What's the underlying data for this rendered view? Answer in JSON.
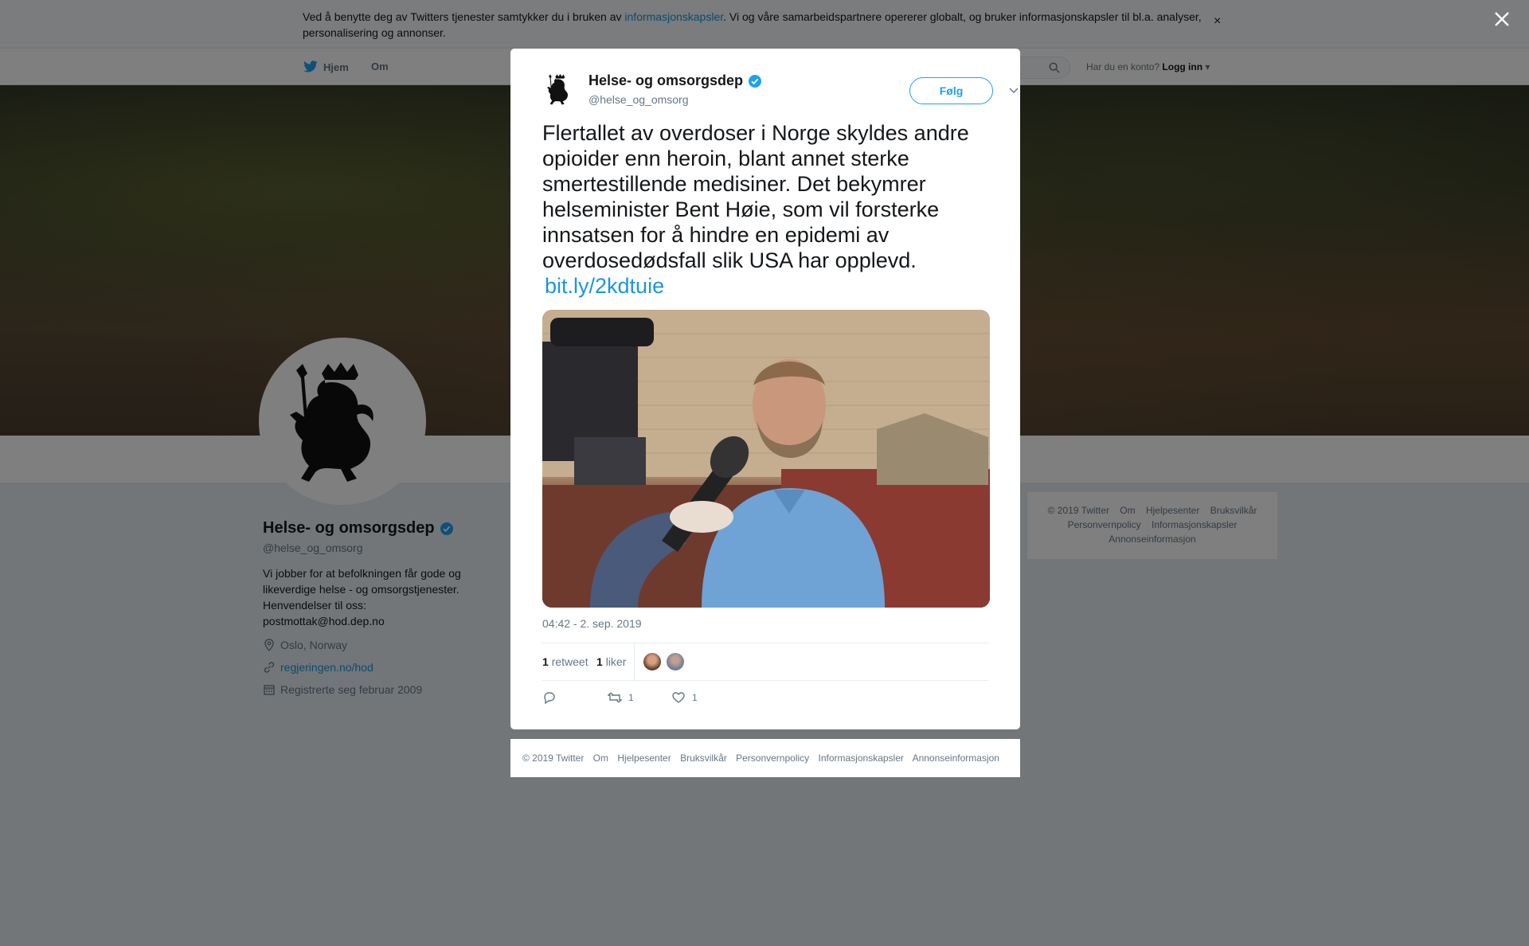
{
  "cookie_bar": {
    "text_before": "Ved å benytte deg av Twitters tjenester samtykker du i bruken av ",
    "link": "informasjonskapsler",
    "text_after": ". Vi og våre samarbeidspartnere opererer globalt, og bruker informasjonskapsler til bl.a. analyser, personalisering og annonser.",
    "close": "×"
  },
  "topnav": {
    "home": "Hjem",
    "about": "Om",
    "login_prompt": "Har du en konto?",
    "login": "Logg inn"
  },
  "profile": {
    "name": "Helse- og omsorgsdep",
    "handle": "@helse_og_omsorg",
    "bio": "Vi jobber for at befolkningen får gode og likeverdige helse - og omsorgstjenester. Henvendelser til oss: postmottak@hod.dep.no",
    "location": "Oslo, Norway",
    "website": "regjeringen.no/hod",
    "joined": "Registrerte seg februar 2009"
  },
  "side_footer": {
    "items": [
      "© 2019 Twitter",
      "Om",
      "Hjelpesenter",
      "Bruksvilkår",
      "Personvernpolicy",
      "Informasjonskapsler",
      "Annonseinformasjon"
    ]
  },
  "tweet": {
    "name": "Helse- og omsorgsdep",
    "handle": "@helse_og_omsorg",
    "follow": "Følg",
    "text": "Flertallet av overdoser i Norge skyldes andre opioider enn heroin, blant annet sterke smertestillende medisiner. Det bekymrer helseminister Bent Høie, som vil forsterke innsatsen for å hindre en epidemi av overdosedødsfall slik USA har opplevd.",
    "link": "bit.ly/2kdtuie",
    "timestamp": "04:42 - 2. sep. 2019",
    "retweets_count": "1",
    "retweets_label": "retweet",
    "likes_count": "1",
    "likes_label": "liker",
    "action_retweets": "1",
    "action_likes": "1"
  },
  "modal_footer": {
    "items": [
      "© 2019 Twitter",
      "Om",
      "Hjelpesenter",
      "Bruksvilkår",
      "Personvernpolicy",
      "Informasjonskapsler",
      "Annonseinformasjon"
    ]
  },
  "colors": {
    "accent": "#1da1f2",
    "link": "#1b95e0",
    "muted": "#657786",
    "overlay": "rgba(0,0,0,0.5)"
  },
  "icons": [
    "twitter-bird-icon",
    "search-icon",
    "verified-icon",
    "location-icon",
    "link-icon",
    "calendar-icon",
    "close-icon",
    "chevron-down-icon",
    "reply-icon",
    "retweet-icon",
    "like-icon"
  ]
}
